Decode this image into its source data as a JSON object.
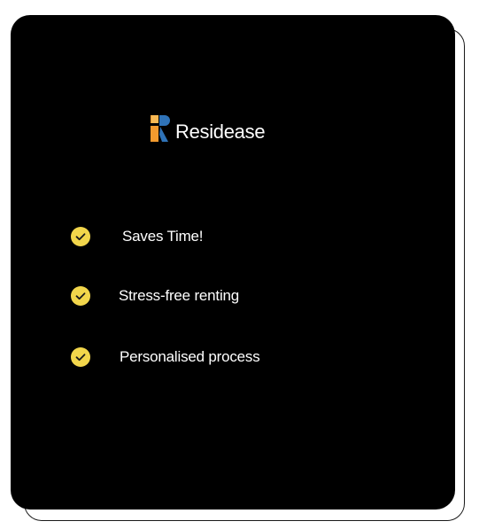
{
  "brand": {
    "name": "Residease",
    "icon": "residease-logo-icon"
  },
  "features": [
    {
      "label": "Saves Time!",
      "icon": "check-circle-icon"
    },
    {
      "label": "Stress-free renting",
      "icon": "check-circle-icon"
    },
    {
      "label": "Personalised process",
      "icon": "check-circle-icon"
    }
  ],
  "colors": {
    "card_background": "#000000",
    "check_fill": "#F2D64B",
    "logo_orange": "#F39A2E",
    "logo_blue": "#2F73B8",
    "text": "#FFFFFF"
  }
}
